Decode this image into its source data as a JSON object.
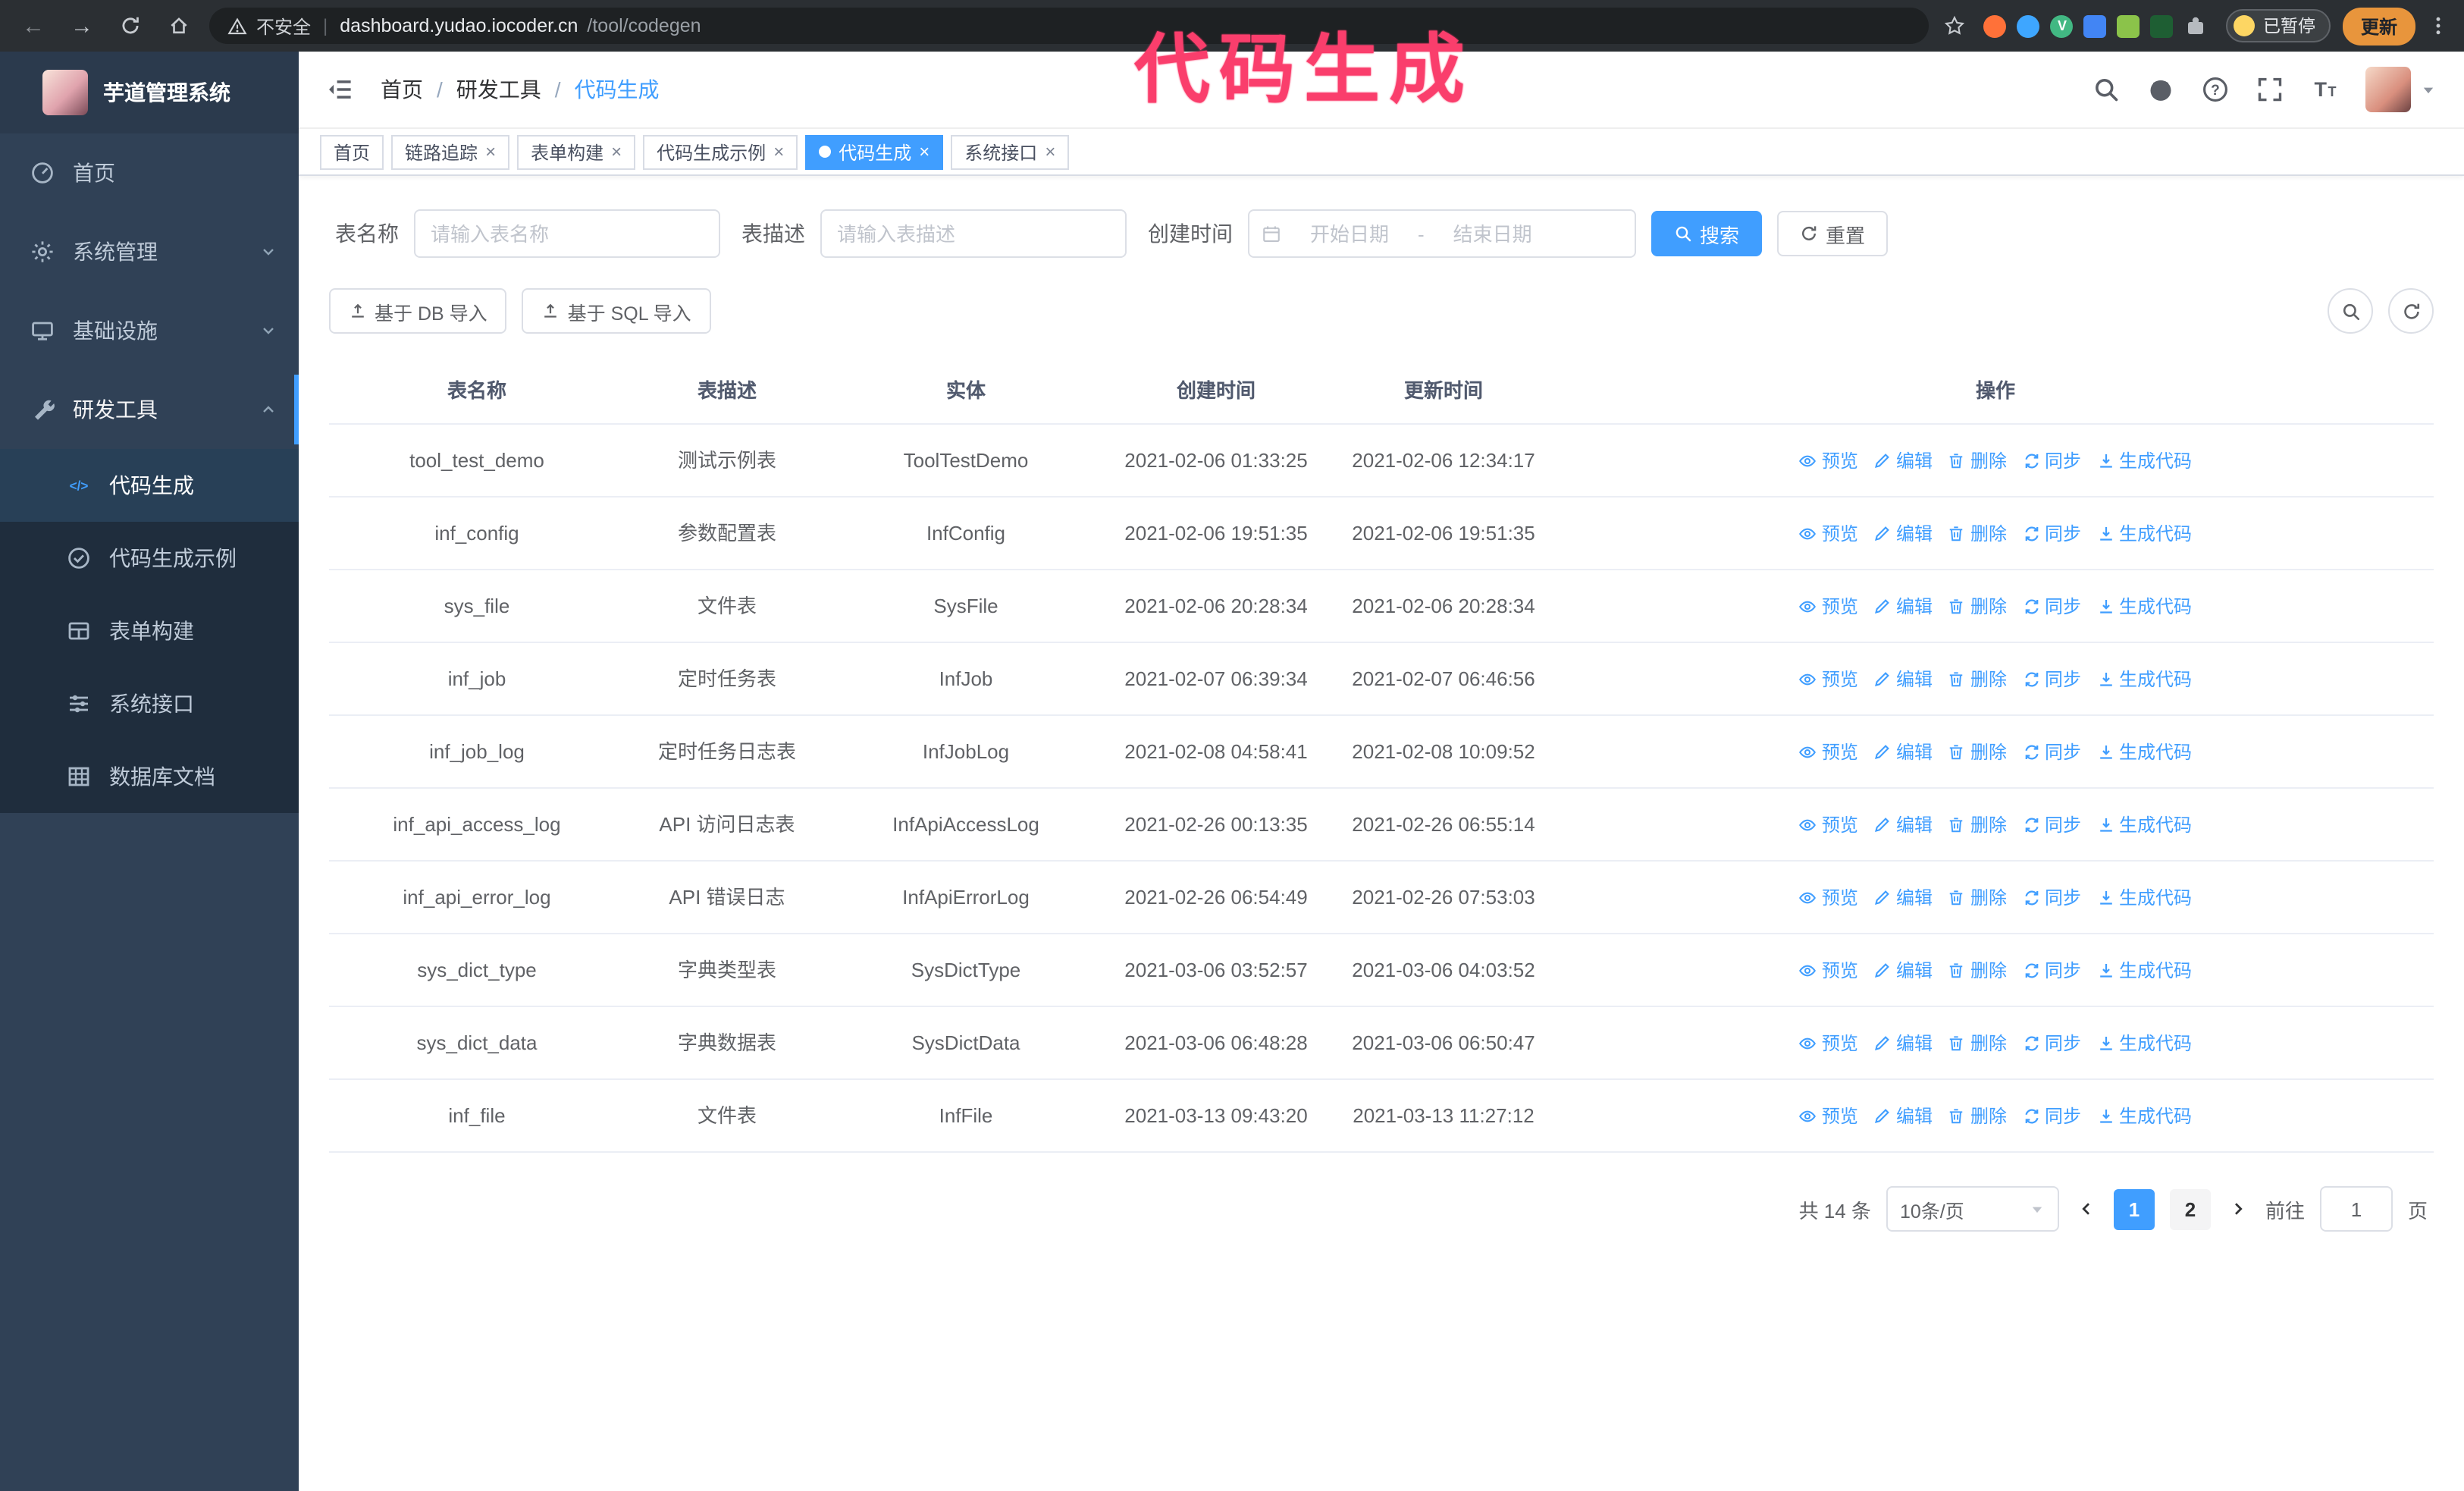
{
  "colors": {
    "accent": "#409eff",
    "annotation": "#fa3e6c",
    "sidebar_bg": "#304156",
    "submenu_bg": "#1f2d3d"
  },
  "annotation": {
    "text": "代码生成"
  },
  "browser": {
    "security_label": "不安全",
    "url_host": "dashboard.yudao.iocoder.cn",
    "url_path": "/tool/codegen",
    "extension_v_badge": "V",
    "paused_badge": "已暂停",
    "update_button": "更新"
  },
  "sidebar": {
    "logo_title": "芋道管理系统",
    "items": [
      {
        "label": "首页"
      },
      {
        "label": "系统管理"
      },
      {
        "label": "基础设施"
      },
      {
        "label": "研发工具"
      }
    ],
    "subitems": [
      {
        "label": "代码生成",
        "active": true
      },
      {
        "label": "代码生成示例",
        "active": false
      },
      {
        "label": "表单构建",
        "active": false
      },
      {
        "label": "系统接口",
        "active": false
      },
      {
        "label": "数据库文档",
        "active": false
      }
    ]
  },
  "header": {
    "breadcrumb": [
      "首页",
      "研发工具",
      "代码生成"
    ]
  },
  "tabs": [
    {
      "label": "首页",
      "closable": false,
      "active": false
    },
    {
      "label": "链路追踪",
      "closable": true,
      "active": false
    },
    {
      "label": "表单构建",
      "closable": true,
      "active": false
    },
    {
      "label": "代码生成示例",
      "closable": true,
      "active": false
    },
    {
      "label": "代码生成",
      "closable": true,
      "active": true
    },
    {
      "label": "系统接口",
      "closable": true,
      "active": false
    }
  ],
  "filters": {
    "name_label": "表名称",
    "name_placeholder": "请输入表名称",
    "desc_label": "表描述",
    "desc_placeholder": "请输入表描述",
    "time_label": "创建时间",
    "start_placeholder": "开始日期",
    "end_placeholder": "结束日期",
    "range_separator": "-",
    "search_button": "搜索",
    "reset_button": "重置"
  },
  "toolbar": {
    "import_db": "基于 DB 导入",
    "import_sql": "基于 SQL 导入"
  },
  "table": {
    "columns": [
      "表名称",
      "表描述",
      "实体",
      "创建时间",
      "更新时间",
      "操作"
    ],
    "rows": [
      {
        "name": "tool_test_demo",
        "desc": "测试示例表",
        "entity": "ToolTestDemo",
        "created": "2021-02-06 01:33:25",
        "updated": "2021-02-06 12:34:17"
      },
      {
        "name": "inf_config",
        "desc": "参数配置表",
        "entity": "InfConfig",
        "created": "2021-02-06 19:51:35",
        "updated": "2021-02-06 19:51:35"
      },
      {
        "name": "sys_file",
        "desc": "文件表",
        "entity": "SysFile",
        "created": "2021-02-06 20:28:34",
        "updated": "2021-02-06 20:28:34"
      },
      {
        "name": "inf_job",
        "desc": "定时任务表",
        "entity": "InfJob",
        "created": "2021-02-07 06:39:34",
        "updated": "2021-02-07 06:46:56"
      },
      {
        "name": "inf_job_log",
        "desc": "定时任务日志表",
        "entity": "InfJobLog",
        "created": "2021-02-08 04:58:41",
        "updated": "2021-02-08 10:09:52"
      },
      {
        "name": "inf_api_access_log",
        "desc": "API 访问日志表",
        "entity": "InfApiAccessLog",
        "created": "2021-02-26 00:13:35",
        "updated": "2021-02-26 06:55:14"
      },
      {
        "name": "inf_api_error_log",
        "desc": "API 错误日志",
        "entity": "InfApiErrorLog",
        "created": "2021-02-26 06:54:49",
        "updated": "2021-02-26 07:53:03"
      },
      {
        "name": "sys_dict_type",
        "desc": "字典类型表",
        "entity": "SysDictType",
        "created": "2021-03-06 03:52:57",
        "updated": "2021-03-06 04:03:52"
      },
      {
        "name": "sys_dict_data",
        "desc": "字典数据表",
        "entity": "SysDictData",
        "created": "2021-03-06 06:48:28",
        "updated": "2021-03-06 06:50:47"
      },
      {
        "name": "inf_file",
        "desc": "文件表",
        "entity": "InfFile",
        "created": "2021-03-13 09:43:20",
        "updated": "2021-03-13 11:27:12"
      }
    ]
  },
  "actions": {
    "preview": "预览",
    "edit": "编辑",
    "delete": "删除",
    "sync": "同步",
    "generate": "生成代码"
  },
  "pagination": {
    "total": "共 14 条",
    "page_size": "10条/页",
    "pages": [
      "1",
      "2"
    ],
    "active_page": "1",
    "goto_label": "前往",
    "goto_value": "1",
    "page_unit": "页"
  }
}
